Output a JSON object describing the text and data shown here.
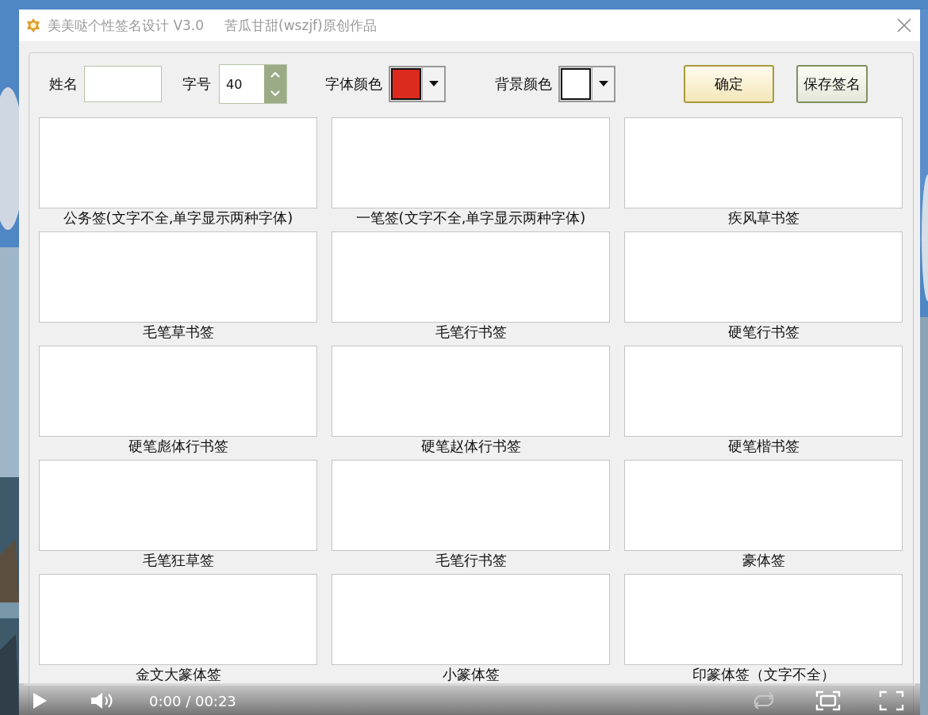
{
  "window": {
    "title": "美美哒个性签名设计 V3.0",
    "author": "苦瓜甘甜(wszjf)原创作品"
  },
  "toolbar": {
    "name_label": "姓名",
    "size_label": "字号",
    "size_value": "40",
    "font_color": {
      "label": "字体颜色",
      "color": "#dd2a1f"
    },
    "background_color": {
      "label": "背景颜色",
      "color": "#ffffff"
    },
    "buttons": [
      {
        "label": "确定",
        "default": true
      },
      {
        "label": "保存签名",
        "default": false
      }
    ]
  },
  "styles": [
    {
      "label": "公务签(文字不全,单字显示两种字体)"
    },
    {
      "label": "一笔签(文字不全,单字显示两种字体)"
    },
    {
      "label": "疾风草书签"
    },
    {
      "label": "毛笔草书签"
    },
    {
      "label": "毛笔行书签"
    },
    {
      "label": "硬笔行书签"
    },
    {
      "label": "硬笔彪体行书签"
    },
    {
      "label": "硬笔赵体行书签"
    },
    {
      "label": "硬笔楷书签"
    },
    {
      "label": "毛笔狂草签"
    },
    {
      "label": "毛笔行书签"
    },
    {
      "label": "豪体签"
    },
    {
      "label": "金文大篆体签"
    },
    {
      "label": "小篆体签"
    },
    {
      "label": "印篆体签（文字不全）"
    }
  ],
  "player": {
    "time": "0:00 / 00:23"
  }
}
